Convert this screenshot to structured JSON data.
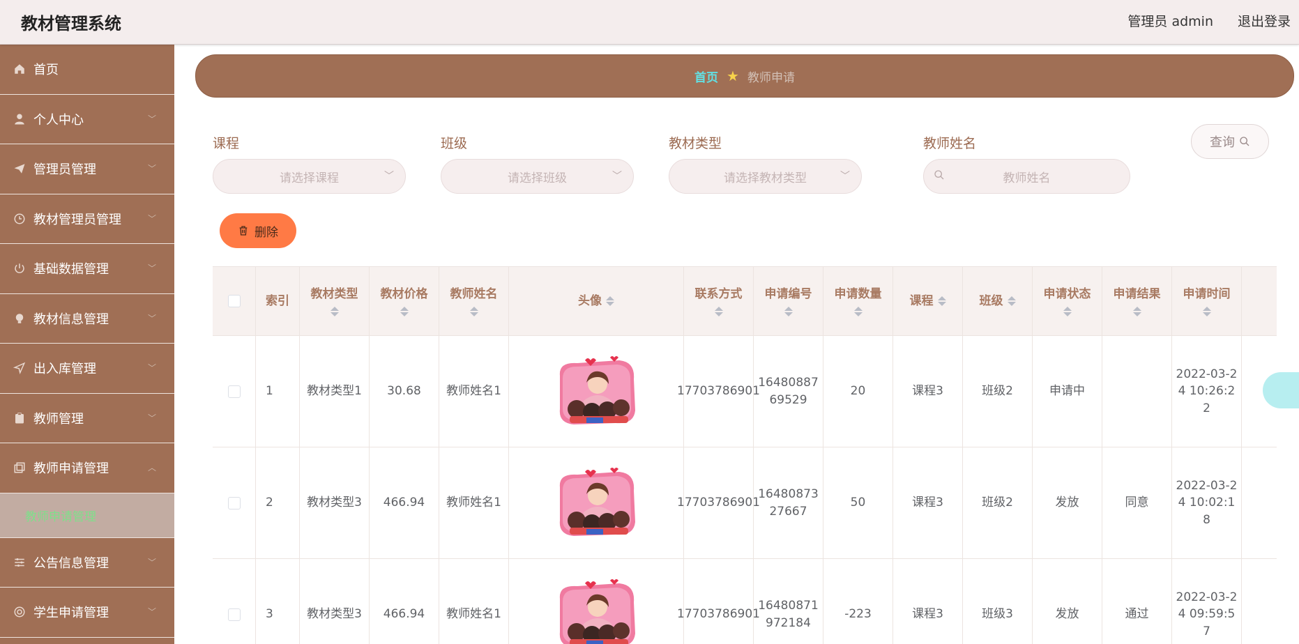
{
  "header": {
    "app_title": "教材管理系统",
    "admin_label": "管理员 admin",
    "logout_label": "退出登录"
  },
  "sidebar": {
    "items": [
      {
        "label": "首页",
        "icon": "home-icon"
      },
      {
        "label": "个人中心",
        "icon": "user-icon"
      },
      {
        "label": "管理员管理",
        "icon": "paper-plane-icon"
      },
      {
        "label": "教材管理员管理",
        "icon": "clock-icon"
      },
      {
        "label": "基础数据管理",
        "icon": "power-icon"
      },
      {
        "label": "教材信息管理",
        "icon": "bulb-icon"
      },
      {
        "label": "出入库管理",
        "icon": "send-icon"
      },
      {
        "label": "教师管理",
        "icon": "clipboard-icon"
      },
      {
        "label": "教师申请管理",
        "icon": "copy-icon",
        "expanded": true
      },
      {
        "label": "公告信息管理",
        "icon": "sliders-icon"
      },
      {
        "label": "学生申请管理",
        "icon": "target-icon"
      }
    ],
    "submenu_active": "教师申请管理"
  },
  "breadcrumb": {
    "home": "首页",
    "current": "教师申请"
  },
  "filters": {
    "course_label": "课程",
    "course_placeholder": "请选择课程",
    "class_label": "班级",
    "class_placeholder": "请选择班级",
    "type_label": "教材类型",
    "type_placeholder": "请选择教材类型",
    "teacher_label": "教师姓名",
    "teacher_placeholder": "教师姓名",
    "query_label": "查询"
  },
  "actions": {
    "delete_label": "删除"
  },
  "table": {
    "columns": [
      "索引",
      "教材类型",
      "教材价格",
      "教师姓名",
      "头像",
      "联系方式",
      "申请编号",
      "申请数量",
      "课程",
      "班级",
      "申请状态",
      "申请结果",
      "申请时间"
    ],
    "rows": [
      {
        "index": "1",
        "type": "教材类型1",
        "price": "30.68",
        "teacher": "教师姓名1",
        "phone": "17703786901",
        "apply_no": "1648088769529",
        "qty": "20",
        "course": "课程3",
        "class": "班级2",
        "status": "申请中",
        "result": "",
        "time": "2022-03-24 10:26:22"
      },
      {
        "index": "2",
        "type": "教材类型3",
        "price": "466.94",
        "teacher": "教师姓名1",
        "phone": "17703786901",
        "apply_no": "1648087327667",
        "qty": "50",
        "course": "课程3",
        "class": "班级2",
        "status": "发放",
        "result": "同意",
        "time": "2022-03-24 10:02:18"
      },
      {
        "index": "3",
        "type": "教材类型3",
        "price": "466.94",
        "teacher": "教师姓名1",
        "phone": "17703786901",
        "apply_no": "16480871972184",
        "qty": "-223",
        "course": "课程3",
        "class": "班级3",
        "status": "发放",
        "result": "通过",
        "time": "2022-03-24 09:59:57"
      }
    ]
  },
  "colors": {
    "sidebar_bg": "#a06f55",
    "accent_cyan": "#62e0e3",
    "delete_orange": "#ff7a45",
    "active_sub_text": "#7ee08a"
  }
}
